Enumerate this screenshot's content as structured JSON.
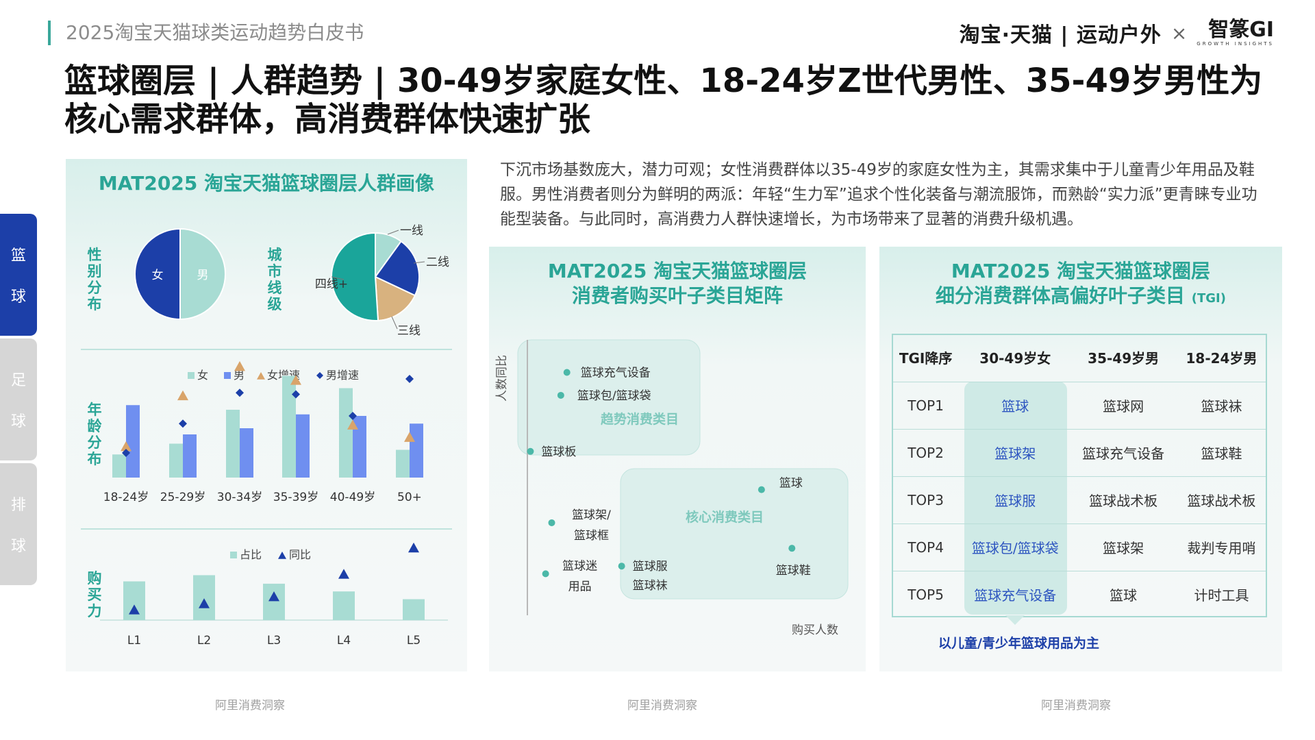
{
  "header": {
    "doc_title": "2025淘宝天猫球类运动趋势白皮书",
    "brand_main": "淘宝·天猫 | 运动户外",
    "brand_times": "×",
    "brand_partner": "智篆GI",
    "brand_partner_sub": "GROWTH INSIGHTS"
  },
  "title": "篮球圈层 | 人群趋势 | 30-49岁家庭女性、18-24岁Z世代男性、35-49岁男性为核心需求群体，高消费群体快速扩张",
  "side_tabs": [
    {
      "chars": [
        "篮",
        "球"
      ],
      "active": true
    },
    {
      "chars": [
        "足",
        "球"
      ],
      "active": false
    },
    {
      "chars": [
        "排",
        "球"
      ],
      "active": false
    }
  ],
  "description": "下沉市场基数庞大，潜力可观；女性消费群体以35-49岁的家庭女性为主，其需求集中于儿童青少年用品及鞋服。男性消费者则分为鲜明的两派：年轻“生力军”追求个性化装备与潮流服饰，而熟龄“实力派”更青睐专业功能型装备。与此同时，高消费力人群快速增长，为市场带来了显著的消费升级机遇。",
  "left_panel": {
    "title": "MAT2025 淘宝天猫篮球圈层人群画像",
    "gender_label": "性别分布",
    "city_label": "城市线级",
    "age_label": "年龄分布",
    "buy_label": "购买力",
    "source": "阿里消费洞察"
  },
  "middle_panel": {
    "title_line1": "MAT2025 淘宝天猫篮球圈层",
    "title_line2": "消费者购买叶子类目矩阵",
    "source": "阿里消费洞察"
  },
  "right_panel": {
    "title_line1": "MAT2025 淘宝天猫篮球圈层",
    "title_line2": "细分消费群体高偏好叶子类目",
    "title_tag": "(TGI)",
    "note": "以儿童/青少年篮球用品为主",
    "source": "阿里消费洞察"
  },
  "tgi_table": {
    "headers": [
      "TGI降序",
      "30-49岁女",
      "35-49岁男",
      "18-24岁男"
    ],
    "rows": [
      [
        "TOP1",
        "篮球",
        "篮球网",
        "篮球袜"
      ],
      [
        "TOP2",
        "篮球架",
        "篮球充气设备",
        "篮球鞋"
      ],
      [
        "TOP3",
        "篮球服",
        "篮球战术板",
        "篮球战术板"
      ],
      [
        "TOP4",
        "篮球包/篮球袋",
        "篮球架",
        "裁判专用哨"
      ],
      [
        "TOP5",
        "篮球充气设备",
        "篮球",
        "计时工具"
      ]
    ]
  },
  "colors": {
    "teal": "#2aa596",
    "navy": "#1c3fa8",
    "light_teal": "#a8dcd3",
    "blue_bar": "#6f8ff0",
    "tan": "#d8b27f",
    "pie_teal": "#1aa59a",
    "orange_tri": "#d9a46a"
  },
  "chart_data": [
    {
      "type": "pie",
      "categories": [
        "女",
        "男"
      ],
      "values": [
        50,
        50
      ]
    },
    {
      "type": "pie",
      "categories": [
        "一线",
        "二线",
        "三线",
        "四线+"
      ],
      "values": [
        10,
        22,
        17,
        51
      ]
    },
    {
      "type": "bar",
      "categories": [
        "18-24岁",
        "25-29岁",
        "30-34岁",
        "35-39岁",
        "40-49岁",
        "50+"
      ],
      "series": [
        {
          "name": "女",
          "values": [
            1.5,
            2.2,
            4.4,
            6.6,
            5.8,
            1.8
          ]
        },
        {
          "name": "男",
          "values": [
            4.7,
            2.8,
            3.2,
            4.1,
            4.0,
            3.5
          ]
        },
        {
          "name": "女增速",
          "values": [
            2.0,
            5.3,
            7.2,
            6.3,
            3.4,
            2.6
          ]
        },
        {
          "name": "男增速",
          "values": [
            1.6,
            3.5,
            5.5,
            5.4,
            4.0,
            6.4
          ]
        }
      ],
      "ylim": [
        0,
        8
      ]
    },
    {
      "type": "bar",
      "categories": [
        "L1",
        "L2",
        "L3",
        "L4",
        "L5"
      ],
      "series": [
        {
          "name": "占比",
          "values": [
            5.0,
            5.8,
            4.7,
            3.7,
            2.7
          ]
        },
        {
          "name": "同比",
          "values": [
            0.6,
            1.4,
            2.3,
            5.2,
            8.6
          ]
        }
      ],
      "ylim": [
        0,
        10
      ]
    },
    {
      "type": "scatter",
      "xlabel": "购买人数",
      "ylabel": "人数同比",
      "xlim": [
        0,
        10
      ],
      "ylim": [
        0,
        10
      ],
      "groups": [
        "趋势消费类目",
        "核心消费类目"
      ],
      "points": [
        {
          "label": "篮球充气设备",
          "x": 1.3,
          "y": 9.1
        },
        {
          "label": "篮球包/篮球袋",
          "x": 1.1,
          "y": 8.2
        },
        {
          "label": "篮球板",
          "x": 0.1,
          "y": 6.0
        },
        {
          "label": "篮球",
          "x": 7.7,
          "y": 4.5
        },
        {
          "label": "篮球架/篮球框",
          "x": 0.8,
          "y": 3.2
        },
        {
          "label": "篮球鞋",
          "x": 8.7,
          "y": 2.2
        },
        {
          "label": "篮球服",
          "x": 3.1,
          "y": 1.5
        },
        {
          "label": "篮球袜",
          "x": 3.1,
          "y": 1.5
        },
        {
          "label": "篮球迷用品",
          "x": 0.6,
          "y": 1.2
        }
      ]
    }
  ]
}
